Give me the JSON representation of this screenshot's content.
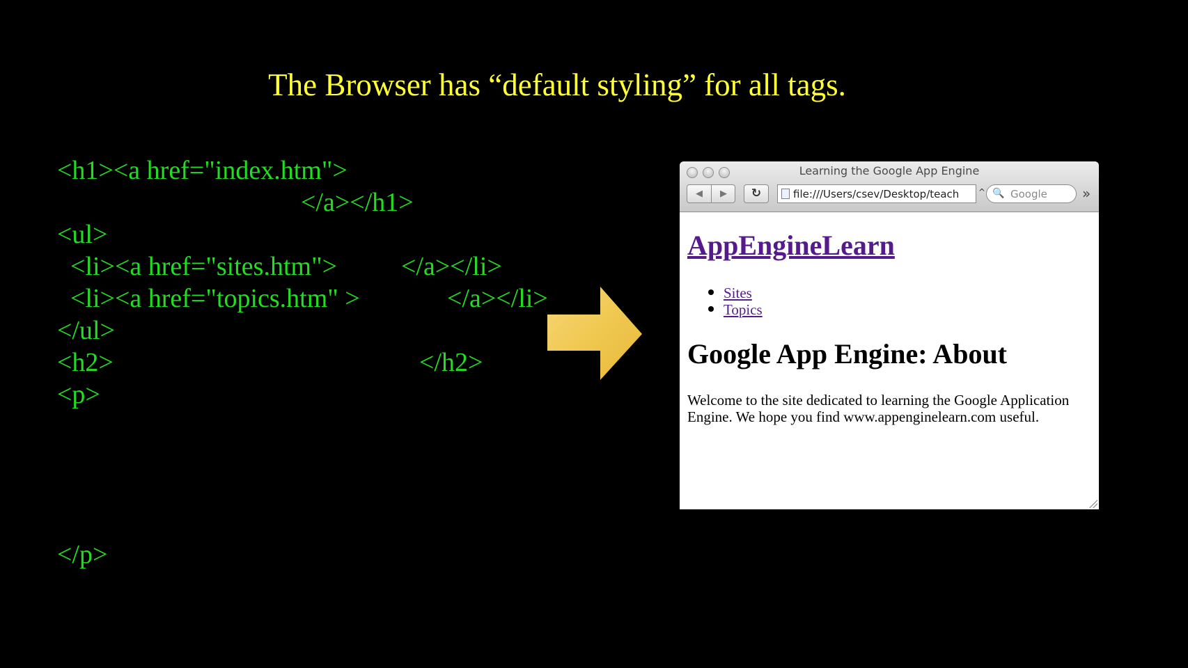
{
  "slide": {
    "title": "The Browser has “default styling” for all tags.",
    "code_lines": [
      "<h1><a href=\"index.htm\">",
      "</a></h1>",
      "<ul>",
      "  <li><a href=\"sites.htm\">",
      "</a></li>",
      "  <li><a href=\"topics.htm\" >",
      "</a></li>",
      "</ul>",
      "<h2>",
      "</h2>",
      "<p>",
      "</p>"
    ],
    "colors": {
      "background": "#000000",
      "title": "#ffff33",
      "code": "#22dd22",
      "arrow": "#f0c850"
    },
    "arrow_icon": "right-arrow-icon"
  },
  "browser": {
    "window_title": "Learning the Google App Engine",
    "back_icon": "◀",
    "forward_icon": "▶",
    "reload_icon": "↻",
    "address": "file:///Users/csev/Desktop/teach",
    "address_dropdown": "^",
    "search_icon_glyph": "🔍",
    "search_placeholder": "Google",
    "overflow_icon": "»",
    "page": {
      "site_title": "AppEngineLearn",
      "nav_items": [
        "Sites",
        "Topics"
      ],
      "heading": "Google App Engine: About",
      "paragraph": "Welcome to the site dedicated to learning the Google Application Engine. We hope you find www.appenginelearn.com useful."
    },
    "colors": {
      "visited_link": "#551a8b",
      "chrome": "#d6d6d6"
    }
  }
}
